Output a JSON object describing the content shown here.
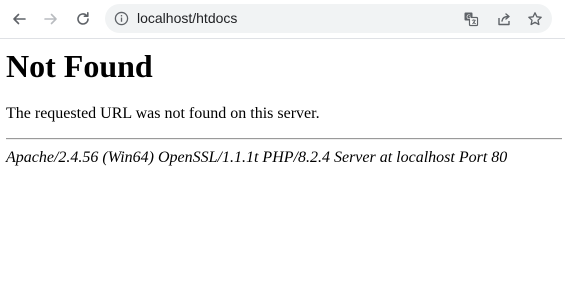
{
  "browser": {
    "address_bar": {
      "url": "localhost/htdocs"
    },
    "icons": {
      "back": "back-arrow-icon",
      "forward": "forward-arrow-icon",
      "reload": "reload-icon",
      "site_info": "info-icon",
      "translate": "translate-icon",
      "share": "share-icon",
      "bookmark": "star-icon"
    }
  },
  "page": {
    "title": "Not Found",
    "message": "The requested URL was not found on this server.",
    "server_signature": "Apache/2.4.56 (Win64) OpenSSL/1.1.1t PHP/8.2.4 Server at localhost Port 80"
  }
}
